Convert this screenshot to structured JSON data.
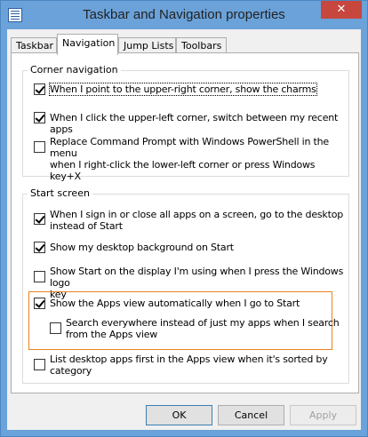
{
  "window": {
    "title": "Taskbar and Navigation properties",
    "close_glyph": "✕"
  },
  "tabs": [
    {
      "label": "Taskbar"
    },
    {
      "label": "Navigation"
    },
    {
      "label": "Jump Lists"
    },
    {
      "label": "Toolbars"
    }
  ],
  "corner": {
    "title": "Corner navigation",
    "options": [
      {
        "lines": [
          "When I point to the upper-right corner, show the charms"
        ],
        "checked": true
      },
      {
        "lines": [
          "When I click the upper-left corner, switch between my recent apps"
        ],
        "checked": true
      },
      {
        "lines": [
          "Replace Command Prompt with Windows PowerShell in the menu",
          "when I right-click the lower-left corner or press Windows key+X"
        ],
        "checked": false
      }
    ]
  },
  "start": {
    "title": "Start screen",
    "options": [
      {
        "lines": [
          "When I sign in or close all apps on a screen, go to the desktop",
          "instead of Start"
        ],
        "checked": true
      },
      {
        "lines": [
          "Show my desktop background on Start"
        ],
        "checked": true
      },
      {
        "lines": [
          "Show Start on the display I'm using when I press the Windows logo",
          "key"
        ],
        "checked": false
      },
      {
        "lines": [
          "Show the Apps view automatically when I go to Start"
        ],
        "checked": true
      },
      {
        "lines": [
          "Search everywhere instead of just my apps when I search",
          "from the Apps view"
        ],
        "checked": false
      },
      {
        "lines": [
          "List desktop apps first in the Apps view when it's sorted by",
          "category"
        ],
        "checked": false
      }
    ]
  },
  "buttons": {
    "ok": "OK",
    "cancel": "Cancel",
    "apply": "Apply"
  }
}
